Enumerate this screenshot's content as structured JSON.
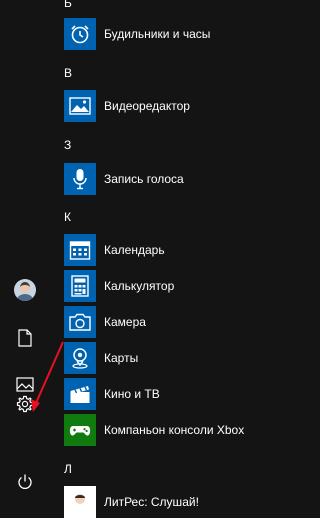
{
  "rail": {
    "items": [
      {
        "name": "avatar",
        "icon": "user-avatar"
      },
      {
        "name": "documents",
        "icon": "document-icon"
      },
      {
        "name": "pictures",
        "icon": "pictures-icon"
      },
      {
        "name": "settings",
        "icon": "gear-icon"
      },
      {
        "name": "power",
        "icon": "power-icon"
      }
    ]
  },
  "groups": [
    {
      "letter": "Б",
      "apps": [
        {
          "label": "Будильники и часы",
          "icon": "alarm-clock-icon"
        }
      ]
    },
    {
      "letter": "В",
      "apps": [
        {
          "label": "Видеоредактор",
          "icon": "photo-video-icon"
        }
      ]
    },
    {
      "letter": "З",
      "apps": [
        {
          "label": "Запись голоса",
          "icon": "microphone-icon"
        }
      ]
    },
    {
      "letter": "К",
      "apps": [
        {
          "label": "Календарь",
          "icon": "calendar-icon"
        },
        {
          "label": "Калькулятор",
          "icon": "calculator-icon"
        },
        {
          "label": "Камера",
          "icon": "camera-icon"
        },
        {
          "label": "Карты",
          "icon": "map-pin-icon"
        },
        {
          "label": "Кино и ТВ",
          "icon": "clapperboard-icon"
        },
        {
          "label": "Компаньон консоли Xbox",
          "icon": "xbox-companion-icon"
        }
      ]
    },
    {
      "letter": "Л",
      "apps": [
        {
          "label": "ЛитРес: Слушай!",
          "icon": "litres-icon"
        }
      ]
    }
  ],
  "colors": {
    "background": "#141414",
    "tile_blue": "#0063b1",
    "tile_green": "#107c10",
    "annotation_arrow": "#e81123"
  }
}
